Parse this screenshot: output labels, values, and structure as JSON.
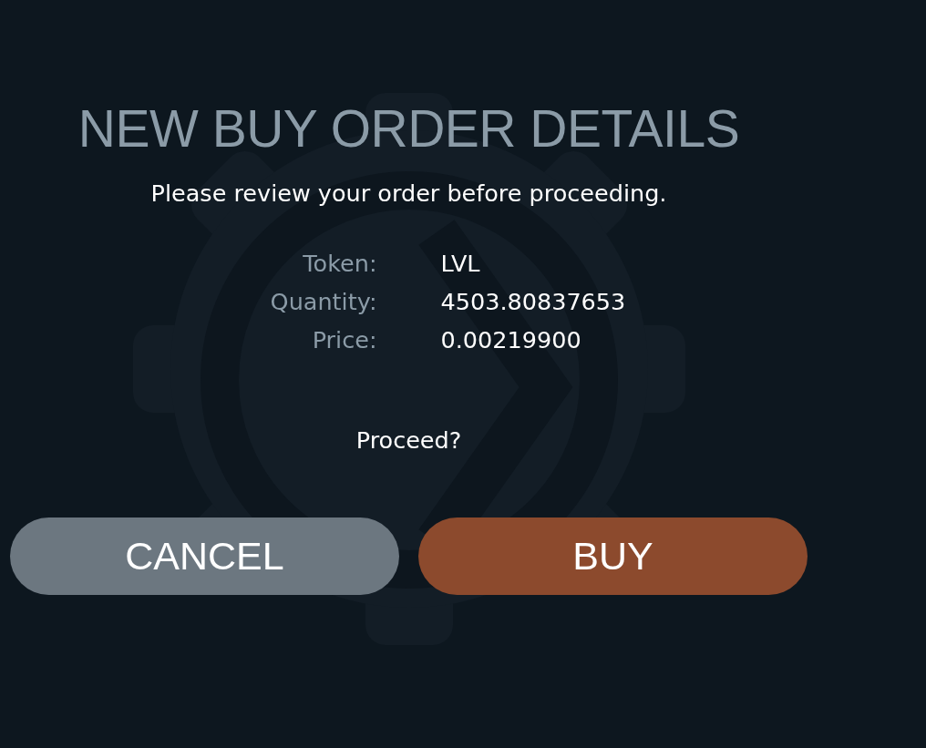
{
  "title": "NEW BUY ORDER DETAILS",
  "subtitle": "Please review your order before proceeding.",
  "details": [
    {
      "label": "Token:",
      "value": "LVL"
    },
    {
      "label": "Quantity:",
      "value": "4503.80837653"
    },
    {
      "label": "Price:",
      "value": "0.00219900"
    }
  ],
  "prompt": "Proceed?",
  "buttons": [
    {
      "label": "CANCEL",
      "kind": "secondary"
    },
    {
      "label": "BUY",
      "kind": "primary"
    }
  ]
}
